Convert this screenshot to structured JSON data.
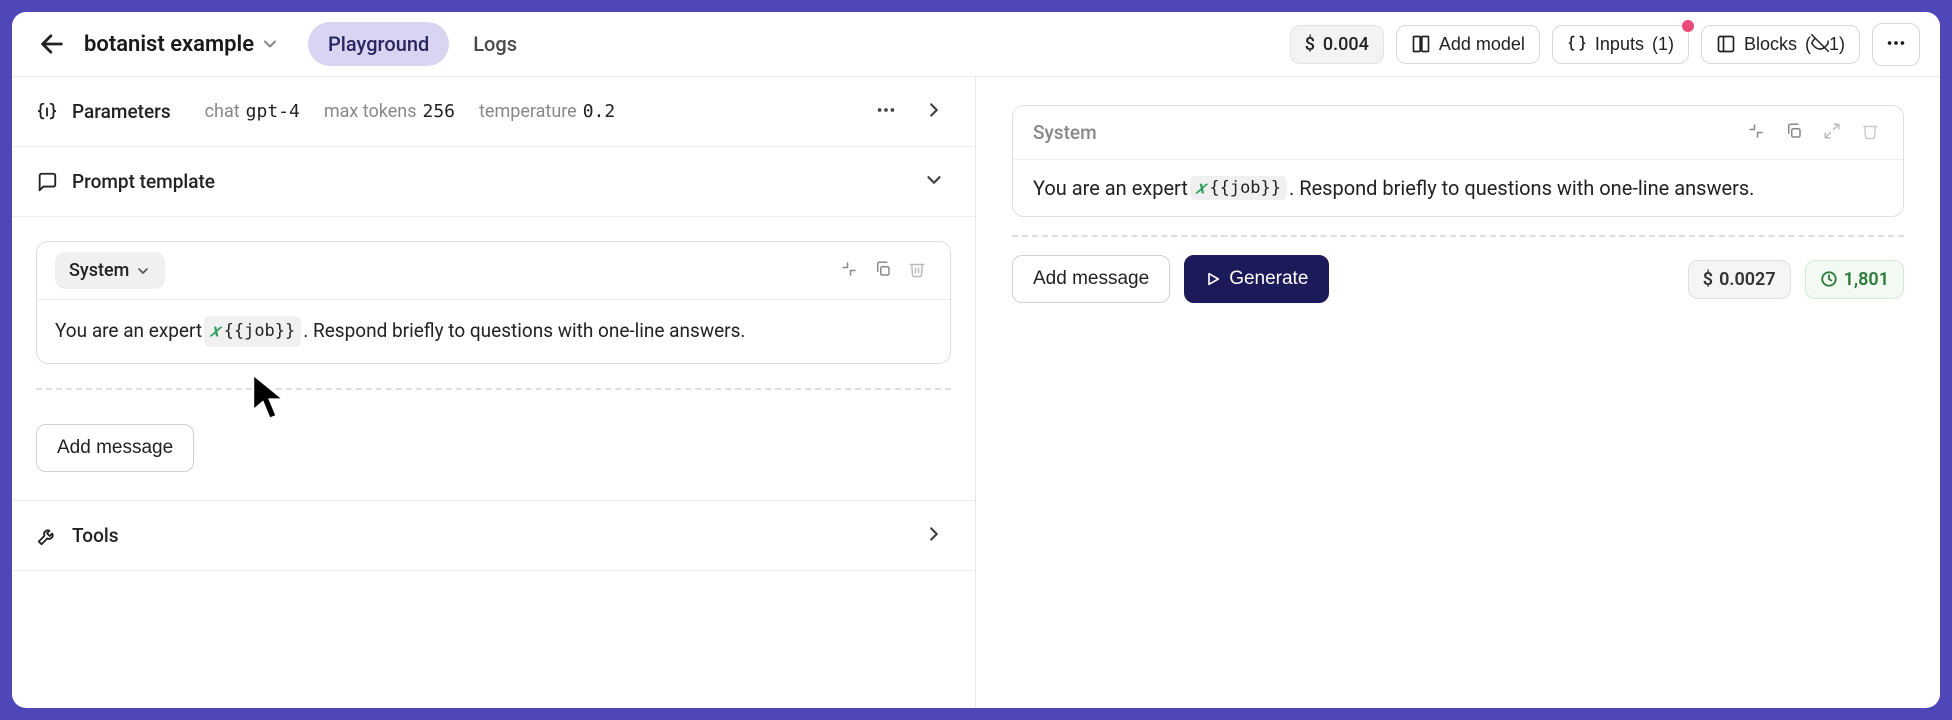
{
  "header": {
    "name": "botanist example",
    "tabs": [
      {
        "label": "Playground",
        "active": true
      },
      {
        "label": "Logs",
        "active": false
      }
    ],
    "price": "0.004",
    "addModel": "Add model",
    "inputs": {
      "label": "Inputs",
      "count": "(1)"
    },
    "blocks": {
      "label": "Blocks",
      "count": "1"
    }
  },
  "parameters": {
    "title": "Parameters",
    "chat": "chat",
    "model": "gpt-4",
    "maxTokensLabel": "max tokens",
    "maxTokens": "256",
    "temperatureLabel": "temperature",
    "temperature": "0.2"
  },
  "promptTemplate": {
    "title": "Prompt template",
    "message": {
      "role": "System",
      "prefix": "You are an expert ",
      "variable": "{{job}}",
      "suffix": ". Respond briefly to questions with one-line answers."
    },
    "addMessage": "Add message"
  },
  "tools": {
    "title": "Tools"
  },
  "preview": {
    "role": "System",
    "prefix": "You are an expert ",
    "variable": "{{job}}",
    "suffix": ". Respond briefly to questions with one-line answers.",
    "addMessage": "Add message",
    "generate": "Generate",
    "cost": "0.0027",
    "tokens": "1,801"
  }
}
